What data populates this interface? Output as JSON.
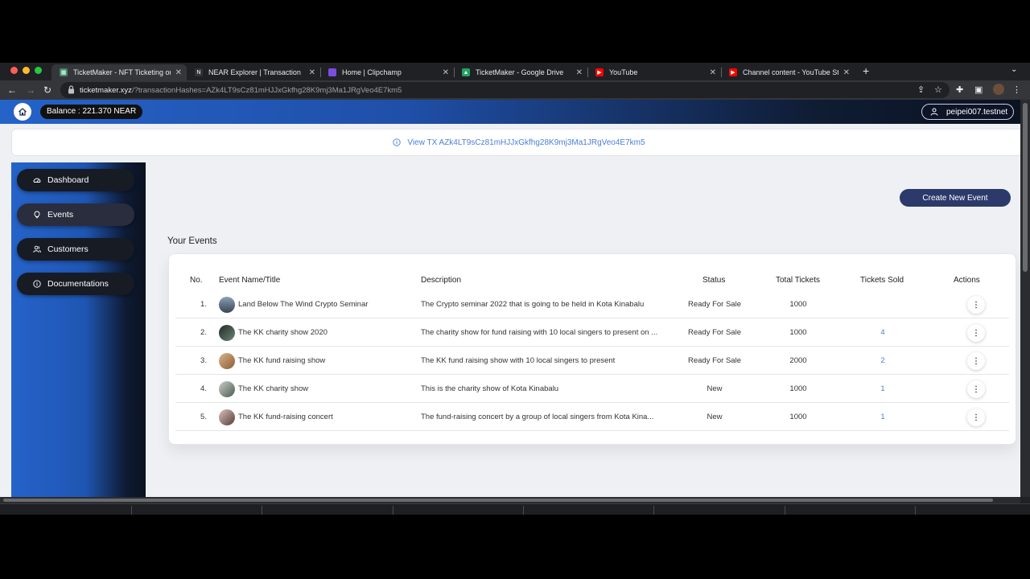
{
  "browser": {
    "tabs": [
      {
        "title": "TicketMaker - NFT Ticketing on",
        "favicon": "ticket-favicon",
        "color": "#3c8d66"
      },
      {
        "title": "NEAR Explorer | Transaction",
        "favicon": "near-favicon",
        "color": "#333333"
      },
      {
        "title": "Home | Clipchamp",
        "favicon": "clipchamp-favicon",
        "color": "#7b4ce0"
      },
      {
        "title": "TicketMaker - Google Drive",
        "favicon": "drive-favicon",
        "color": "#1fa463"
      },
      {
        "title": "YouTube",
        "favicon": "youtube-favicon",
        "color": "#ff0000"
      },
      {
        "title": "Channel content - YouTube Stu",
        "favicon": "youtube-favicon",
        "color": "#ff0000"
      }
    ],
    "url_host": "ticketmaker.xyz",
    "url_rest": "/?transactionHashes=AZk4LT9sCz81mHJJxGkfhg28K9mj3Ma1JRgVeo4E7km5"
  },
  "header": {
    "balance": "Balance : 221.370 NEAR",
    "account": "peipei007.testnet"
  },
  "banner": {
    "text": "View TX AZk4LT9sCz81mHJJxGkfhg28K9mj3Ma1JRgVeo4E7km5"
  },
  "sidebar": {
    "items": [
      {
        "label": "Dashboard",
        "icon": "dashboard-icon"
      },
      {
        "label": "Events",
        "icon": "bulb-icon"
      },
      {
        "label": "Customers",
        "icon": "users-icon"
      },
      {
        "label": "Documentations",
        "icon": "info-icon"
      }
    ]
  },
  "main": {
    "create_label": "Create New Event",
    "section_title": "Your Events",
    "columns": [
      "No.",
      "Event Name/Title",
      "Description",
      "Status",
      "Total Tickets",
      "Tickets Sold",
      "Actions"
    ],
    "rows": [
      {
        "no": "1.",
        "name": "Land Below The Wind Crypto Seminar",
        "description": "The Crypto seminar 2022 that is going to be held in Kota Kinabalu",
        "status": "Ready For Sale",
        "total": "1000",
        "sold": "",
        "avatar": "#4a5a6e"
      },
      {
        "no": "2.",
        "name": "The KK charity show 2020",
        "description": "The charity show for fund raising with 10 local singers to present on ...",
        "status": "Ready For Sale",
        "total": "1000",
        "sold": "4",
        "avatar": "#2e3b36"
      },
      {
        "no": "3.",
        "name": "The KK fund raising show",
        "description": "The KK fund raising show with 10 local singers to present",
        "status": "Ready For Sale",
        "total": "2000",
        "sold": "2",
        "avatar": "#b0835a"
      },
      {
        "no": "4.",
        "name": "The KK charity show",
        "description": "This is the charity show of Kota Kinabalu",
        "status": "New",
        "total": "1000",
        "sold": "1",
        "avatar": "#7c8a80"
      },
      {
        "no": "5.",
        "name": "The KK fund-raising concert",
        "description": "The fund-raising concert by a group of local singers from Kota Kina...",
        "status": "New",
        "total": "1000",
        "sold": "1",
        "avatar": "#8a6a62"
      }
    ]
  }
}
